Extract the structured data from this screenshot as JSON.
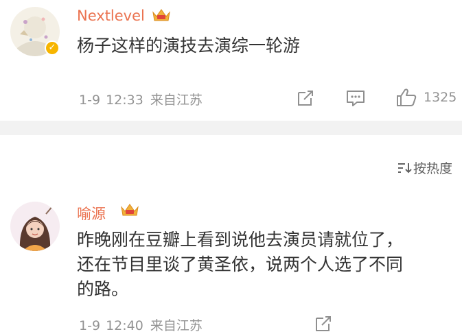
{
  "comments": [
    {
      "username": "Nextlevel",
      "text_lines": [
        "杨子这样的演技去演综一轮游"
      ],
      "date": "1-9",
      "time": "12:33",
      "location": "来自江苏",
      "like_count": "1325",
      "verified": true,
      "icons": [
        "share-icon",
        "comment-icon",
        "like-icon"
      ]
    },
    {
      "username": "喻源",
      "text_lines": [
        "昨晚刚在豆瓣上看到说他去演员请就位了，",
        "还在节目里谈了黄圣依，说两个人选了不同",
        "的路。"
      ],
      "date": "1-9",
      "time": "12:40",
      "location": "来自江苏",
      "icons": [
        "share-icon"
      ]
    }
  ],
  "sort": {
    "label": "按热度",
    "icon": "sort-icon"
  },
  "colors": {
    "username": "#eb7350",
    "meta": "#939393",
    "text": "#333333",
    "divider": "#f2f2f2",
    "verified_badge": "#f7b500"
  }
}
